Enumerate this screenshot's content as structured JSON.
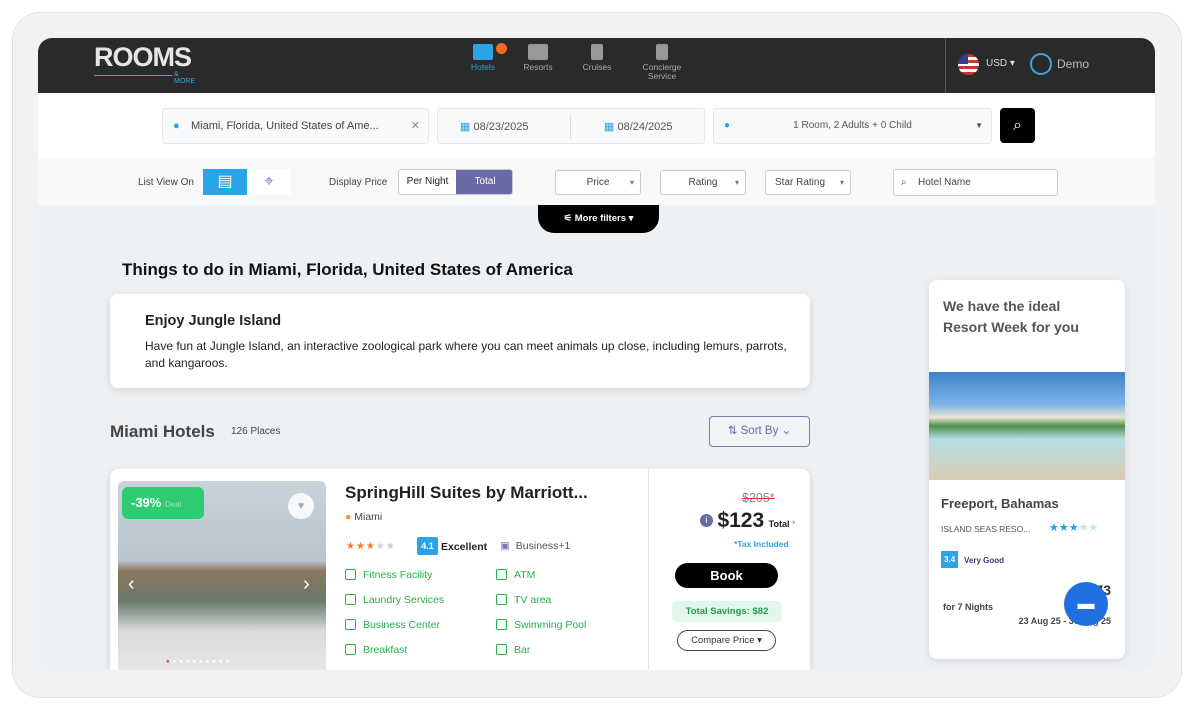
{
  "header": {
    "logo": "ROOMS",
    "logo_sub": "& MORE",
    "nav": [
      {
        "label": "Hotels"
      },
      {
        "label": "Resorts"
      },
      {
        "label": "Cruises"
      },
      {
        "label": "Concierge Service"
      }
    ],
    "currency": "USD",
    "user": "Demo"
  },
  "search": {
    "location": "Miami, Florida, United States of Ame...",
    "checkin": "08/23/2025",
    "checkout": "08/24/2025",
    "guests": "1 Room, 2 Adults + 0 Child"
  },
  "filters": {
    "list_view_label": "List View On",
    "display_price_label": "Display Price",
    "per_night": "Per Night",
    "total": "Total",
    "price": "Price",
    "rating": "Rating",
    "star_rating": "Star Rating",
    "hotel_name_placeholder": "Hotel Name",
    "more_filters": "More filters"
  },
  "things": {
    "title": "Things to do in Miami, Florida, United States of America",
    "item_title": "Enjoy Jungle Island",
    "item_text": "Have fun at Jungle Island, an interactive zoological park where you can meet animals up close, including lemurs, parrots, and kangaroos."
  },
  "hotels": {
    "title": "Miami Hotels",
    "count": "126 Places",
    "sort": "Sort By"
  },
  "hotel": {
    "discount": "-39%",
    "deal": "Deal",
    "name": "SpringHill Suites by Marriott...",
    "location": "Miami",
    "stars": 3,
    "score": "4.1",
    "score_label": "Excellent",
    "type": "Business+1",
    "amenities": [
      "Fitness Facility",
      "ATM",
      "Laundry Services",
      "TV area",
      "Business Center",
      "Swimming Pool",
      "Breakfast",
      "Bar"
    ],
    "old_price": "$205*",
    "price": "$123",
    "price_suffix": "Total",
    "tax": "*Tax Included",
    "book": "Book",
    "savings": "Total Savings: $82",
    "compare": "Compare Price"
  },
  "promo": {
    "title": "We have the ideal Resort Week for you",
    "place": "Freeport, Bahamas",
    "resort": "ISLAND SEAS RESO...",
    "stars": 3,
    "score": "3.4",
    "score_label": "Very Good",
    "price": "$373",
    "nights": "for 7 Nights",
    "dates": "23 Aug 25 - 30 Aug 25"
  }
}
